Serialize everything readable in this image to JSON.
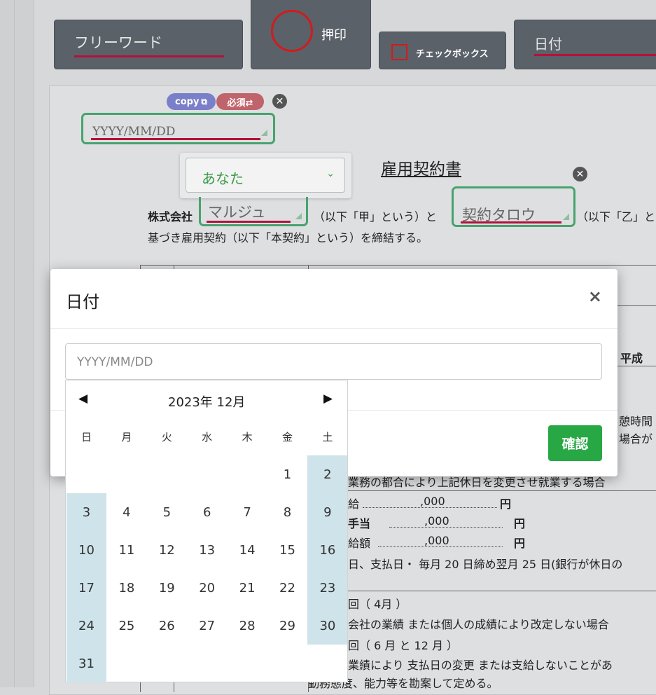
{
  "toolbar": {
    "freeword": "フリーワード",
    "stamp": "押印",
    "checkbox": "チェックボックス",
    "date": "日付"
  },
  "badges": {
    "copy": "copy",
    "required": "必須⇄"
  },
  "date_field": {
    "placeholder": "YYYY/MM/DD"
  },
  "party_select": {
    "value": "あなた"
  },
  "document": {
    "title": "雇用契約書",
    "company_prefix": "株式会社",
    "company_name": "マルジュ",
    "clause_a": "（以下「甲」という）と",
    "employee_name": "契約タロウ",
    "clause_b": "（以下「乙」と",
    "line2": "基づき雇用契約（以下「本契約」という）を締結する。",
    "heisei": "平成",
    "break_time": "憩時間",
    "case_suffix": "場合が",
    "change_holiday": "業務の都合により上記休日を変更させ就業する場合",
    "salary1_label": "給",
    "salary1_value": ",000",
    "salary1_unit": "円",
    "salary2_label": "手当",
    "salary2_value": ",000",
    "salary2_unit": "円",
    "salary3_label": "給額",
    "salary3_value": ",000",
    "salary3_unit": "円",
    "payday": "日、支払日・ 毎月 20 日締め翌月 25 日(銀行が休日の",
    "raise_times": "回（ 4月 ）",
    "raise_note": "会社の業績 または個人の成績により改定しない場合",
    "bonus_times": "回（ 6 月 と 12 月 ）",
    "bonus_note": "業績により 支払日の変更 または支給しないことがあ",
    "bonus_note2": "勤務態度、能力等を勘案して定める。"
  },
  "modal": {
    "title": "日付",
    "close": "×",
    "input_placeholder": "YYYY/MM/DD",
    "confirm": "確認"
  },
  "calendar": {
    "month_label": "2023年 12月",
    "prev": "◀",
    "next": "▶",
    "weekdays": [
      "日",
      "月",
      "火",
      "水",
      "木",
      "金",
      "土"
    ],
    "days": [
      "1",
      "2",
      "3",
      "4",
      "5",
      "6",
      "7",
      "8",
      "9",
      "10",
      "11",
      "12",
      "13",
      "14",
      "15",
      "16",
      "17",
      "18",
      "19",
      "20",
      "21",
      "22",
      "23",
      "24",
      "25",
      "26",
      "27",
      "28",
      "29",
      "30",
      "31"
    ]
  },
  "colors": {
    "accent_red": "#b3123a",
    "field_green": "#47a36d",
    "confirm_green": "#27a844",
    "weekend_bg": "#cfe3ea"
  }
}
